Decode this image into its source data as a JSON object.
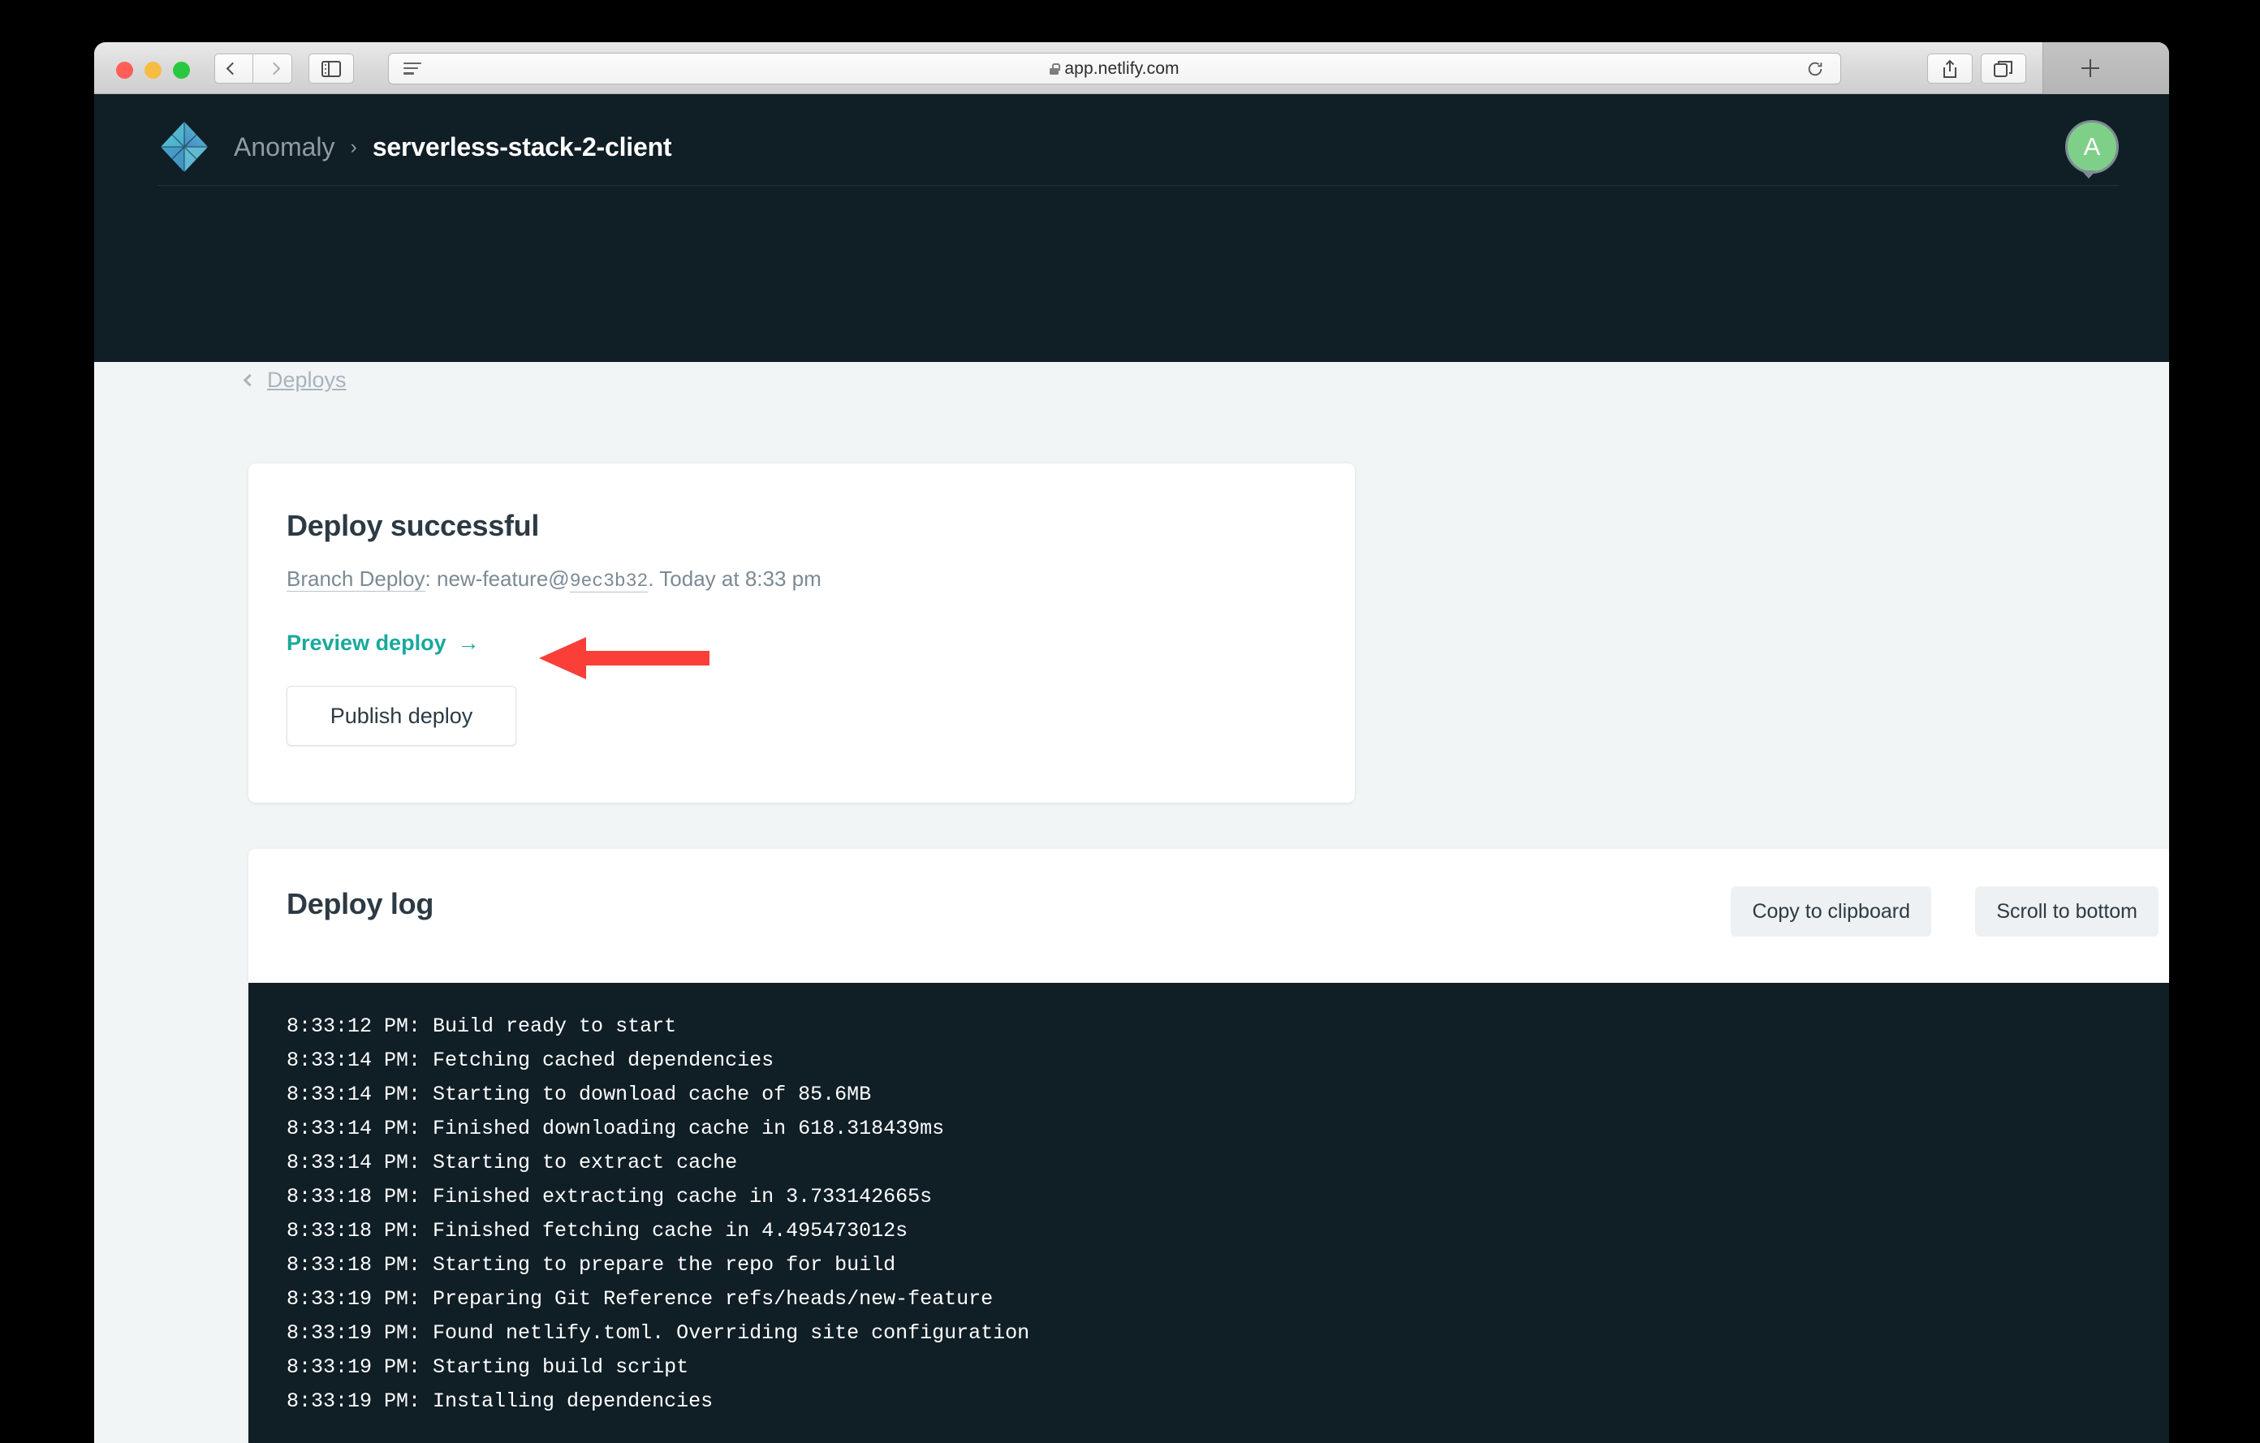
{
  "browser": {
    "url": "app.netlify.com",
    "lock_icon": "lock-icon",
    "reader_icon": "reader-view-icon",
    "reload_icon": "reload-icon",
    "back_icon": "chevron-left-icon",
    "forward_icon": "chevron-right-icon",
    "sidebar_icon": "sidebar-toggle-icon",
    "share_icon": "share-icon",
    "tabs_icon": "tab-overview-icon",
    "new_tab_icon": "plus-icon"
  },
  "header": {
    "logo_name": "netlify-logo",
    "team": "Anomaly",
    "separator": "›",
    "site": "serverless-stack-2-client",
    "avatar_initial": "A",
    "avatar_color": "#7ed089"
  },
  "back_link": {
    "label": "Deploys",
    "icon": "chevron-left-icon"
  },
  "deploy_card": {
    "title": "Deploy successful",
    "meta_label": "Branch Deploy",
    "meta_separator": ": ",
    "meta_branch": "new-feature@",
    "meta_hash": "9ec3b32",
    "meta_time": ". Today at 8:33 pm",
    "preview_link": "Preview deploy",
    "preview_arrow": "→",
    "preview_color": "#18a99c",
    "publish_button": "Publish deploy"
  },
  "annotation": {
    "type": "arrow",
    "direction": "left",
    "color": "#fa3e38",
    "points_to": "Preview deploy"
  },
  "deploy_log": {
    "title": "Deploy log",
    "copy_button": "Copy to clipboard",
    "scroll_button": "Scroll to bottom",
    "lines": [
      "8:33:12 PM: Build ready to start",
      "8:33:14 PM: Fetching cached dependencies",
      "8:33:14 PM: Starting to download cache of 85.6MB",
      "8:33:14 PM: Finished downloading cache in 618.318439ms",
      "8:33:14 PM: Starting to extract cache",
      "8:33:18 PM: Finished extracting cache in 3.733142665s",
      "8:33:18 PM: Finished fetching cache in 4.495473012s",
      "8:33:18 PM: Starting to prepare the repo for build",
      "8:33:19 PM: Preparing Git Reference refs/heads/new-feature",
      "8:33:19 PM: Found netlify.toml. Overriding site configuration",
      "8:33:19 PM: Starting build script",
      "8:33:19 PM: Installing dependencies"
    ]
  },
  "colors": {
    "dark_bg": "#101e26",
    "page_bg": "#f2f5f6",
    "card_bg": "#ffffff",
    "accent_teal": "#18a99c",
    "annotation_red": "#fa3e38"
  }
}
